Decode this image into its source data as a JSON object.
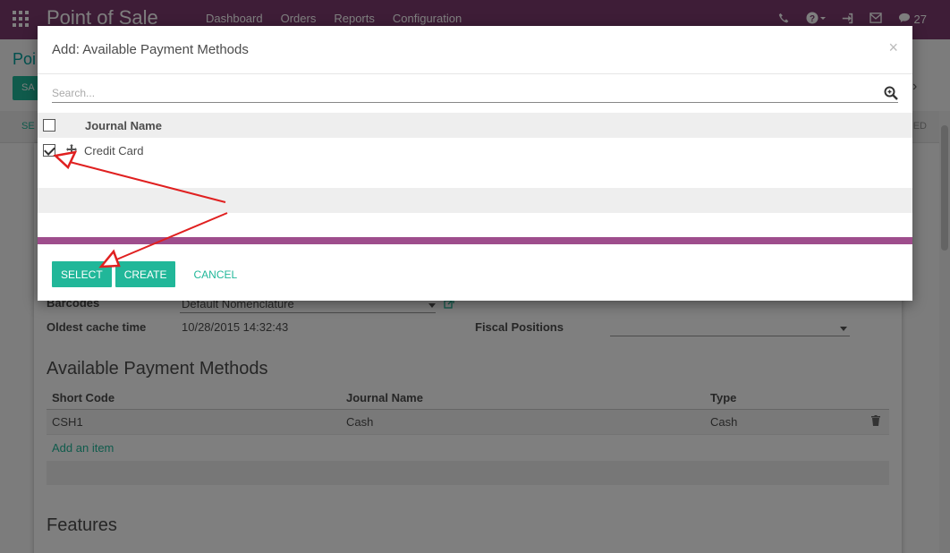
{
  "navbar": {
    "brand": "Point of Sale",
    "menu": [
      "Dashboard",
      "Orders",
      "Reports",
      "Configuration"
    ],
    "messages_count": "27"
  },
  "background": {
    "breadcrumb_peek": "Poi",
    "save_peek": "SA",
    "status_left": "SE",
    "status_right": "ED",
    "barcodes_label": "Barcodes",
    "barcodes_value": "Default Nomenclature",
    "cache_label": "Oldest cache time",
    "cache_value": "10/28/2015 14:32:43",
    "fiscal_label": "Fiscal Positions",
    "payment_title": "Available Payment Methods",
    "columns": [
      "Short Code",
      "Journal Name",
      "Type"
    ],
    "rows": [
      {
        "code": "CSH1",
        "journal": "Cash",
        "type": "Cash"
      }
    ],
    "add_item": "Add an item",
    "features_title": "Features"
  },
  "modal": {
    "title": "Add: Available Payment Methods",
    "close": "×",
    "search_placeholder": "Search...",
    "column_header": "Journal Name",
    "rows": [
      {
        "name": "Credit Card",
        "checked": true
      }
    ],
    "buttons": {
      "select": "SELECT",
      "create": "CREATE",
      "cancel": "CANCEL"
    }
  },
  "colors": {
    "navbar": "#7c3b6e",
    "accent": "#21b799",
    "pager_bar": "#9e4d8c",
    "annotation": "#e02020"
  }
}
